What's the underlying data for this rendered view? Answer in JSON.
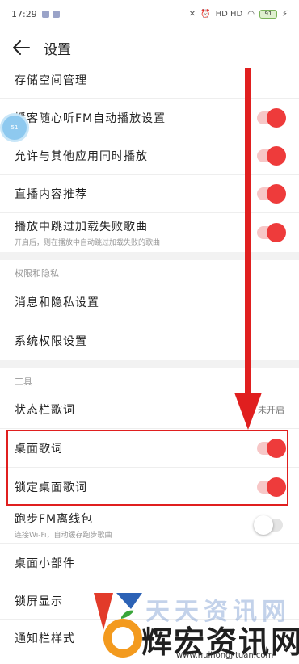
{
  "status_bar": {
    "time": "17:29",
    "right_text": "HD HD",
    "battery": "91"
  },
  "header": {
    "title": "设置"
  },
  "rows_top": [
    {
      "label": "存储空间管理"
    },
    {
      "label": "播客随心听FM自动播放设置",
      "toggle": true
    },
    {
      "label": "允许与其他应用同时播放",
      "toggle": true
    },
    {
      "label": "直播内容推荐",
      "toggle": true
    },
    {
      "label": "播放中跳过加载失败歌曲",
      "sub": "开启后，则在播放中自动跳过加载失败的歌曲",
      "toggle": true
    }
  ],
  "privacy_section": {
    "title": "权限和隐私",
    "items": [
      {
        "label": "消息和隐私设置"
      },
      {
        "label": "系统权限设置"
      }
    ]
  },
  "tools_section": {
    "title": "工具",
    "items": [
      {
        "label": "状态栏歌词",
        "value": "未开启"
      },
      {
        "label": "桌面歌词",
        "toggle": true
      },
      {
        "label": "锁定桌面歌词",
        "toggle": true
      },
      {
        "label": "跑步FM离线包",
        "sub": "连接Wi-Fi，自动缓存跑步歌曲",
        "toggle": false
      },
      {
        "label": "桌面小部件"
      },
      {
        "label": "锁屏显示"
      },
      {
        "label": "通知栏样式"
      }
    ]
  },
  "floating_badge": {
    "text": "51"
  },
  "watermark": {
    "brand_top": "天天资讯网",
    "brand_main": "辉宏资讯网",
    "url": "www.huihongjituan.com"
  },
  "colors": {
    "accent": "#ee3b3b",
    "highlight": "#e01f1f",
    "watermark_blue": "#2c62b6"
  }
}
